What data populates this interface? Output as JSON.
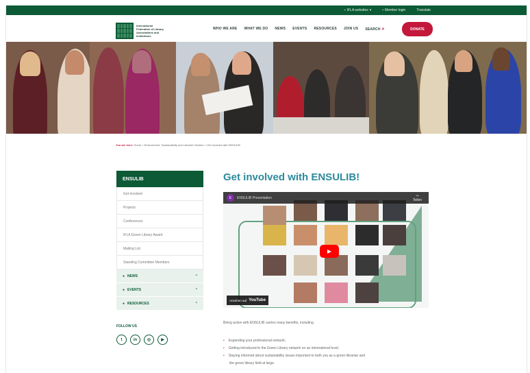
{
  "topbar": {
    "items": [
      "IFLA websites",
      "Member login",
      "Translate"
    ]
  },
  "header": {
    "logo_text": "International Federation of Library Associations and Institutions",
    "nav": [
      "WHO WE ARE",
      "WHAT WE DO",
      "NEWS",
      "EVENTS",
      "RESOURCES",
      "JOIN US",
      "SEARCH"
    ],
    "donate": "DONATE"
  },
  "breadcrumb": {
    "prefix": "You are here:",
    "path": "Home > Environment, Sustainability and Libraries Section > Get involved with ENSULIB"
  },
  "sidebar": {
    "heading": "ENSULIB",
    "items": [
      "Get involved",
      "Projects",
      "Conferences",
      "IFLA Green Library Award",
      "Mailing List",
      "Standing Committee Members"
    ],
    "dropdowns": [
      "NEWS",
      "EVENTS",
      "RESOURCES"
    ],
    "follow_label": "FOLLOW US",
    "social_icons": [
      "twitter-icon",
      "linkedin-icon",
      "instagram-icon",
      "youtube-icon"
    ]
  },
  "main": {
    "title": "Get involved with ENSULIB!",
    "video": {
      "channel_letter": "E",
      "title": "ENSULIB Presentation",
      "share": "Teilen",
      "watch_label": "Ansehen auf",
      "watch_brand": "YouTube"
    },
    "intro": "Being active with ENSULIB carries many benefits, including",
    "bullets": [
      "Expanding your professional network;",
      "Getting introduced to the Green Library network on an international level;",
      "Staying informed about sustainability issues important to both you as a green librarian and"
    ],
    "bullet_continuation": "the green library field at large."
  },
  "colors": {
    "brand_green": "#0c5a36",
    "accent_red": "#c3183b",
    "title_teal": "#2c8a9c"
  }
}
